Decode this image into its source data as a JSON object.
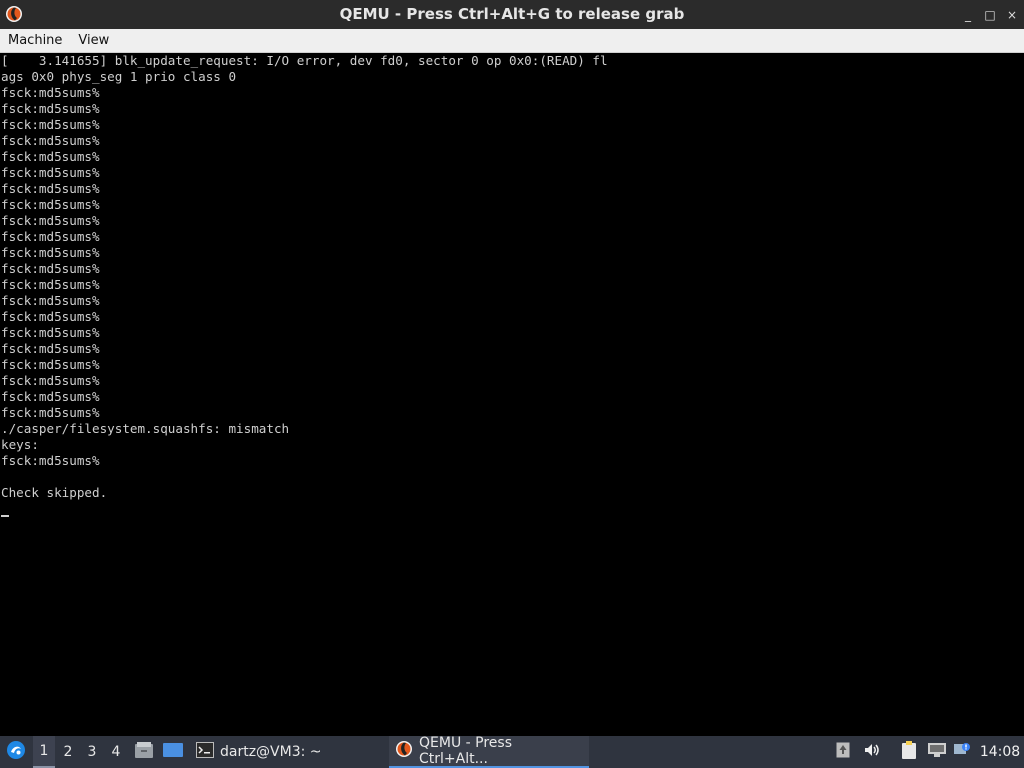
{
  "window": {
    "title": "QEMU - Press Ctrl+Alt+G to release grab",
    "controls": [
      "_",
      "□",
      "×"
    ]
  },
  "menubar": {
    "items": [
      "Machine",
      "View"
    ]
  },
  "terminal": {
    "lines": [
      "[    3.141655] blk_update_request: I/O error, dev fd0, sector 0 op 0x0:(READ) fl",
      "ags 0x0 phys_seg 1 prio class 0",
      "fsck:md5sums%",
      "fsck:md5sums%",
      "fsck:md5sums%",
      "fsck:md5sums%",
      "fsck:md5sums%",
      "fsck:md5sums%",
      "fsck:md5sums%",
      "fsck:md5sums%",
      "fsck:md5sums%",
      "fsck:md5sums%",
      "fsck:md5sums%",
      "fsck:md5sums%",
      "fsck:md5sums%",
      "fsck:md5sums%",
      "fsck:md5sums%",
      "fsck:md5sums%",
      "fsck:md5sums%",
      "fsck:md5sums%",
      "fsck:md5sums%",
      "fsck:md5sums%",
      "fsck:md5sums%",
      "./casper/filesystem.squashfs: mismatch",
      "keys:",
      "fsck:md5sums%",
      "",
      "Check skipped."
    ]
  },
  "taskbar": {
    "workspaces": [
      "1",
      "2",
      "3",
      "4"
    ],
    "active_workspace": "1",
    "tasks": [
      {
        "icon": "terminal-icon",
        "label": "dartz@VM3: ~"
      },
      {
        "icon": "qemu-icon",
        "label": "QEMU - Press Ctrl+Alt..."
      }
    ],
    "clock": "14:08",
    "colors": {
      "panel": "#2f343f",
      "accent": "#5294e2"
    }
  }
}
